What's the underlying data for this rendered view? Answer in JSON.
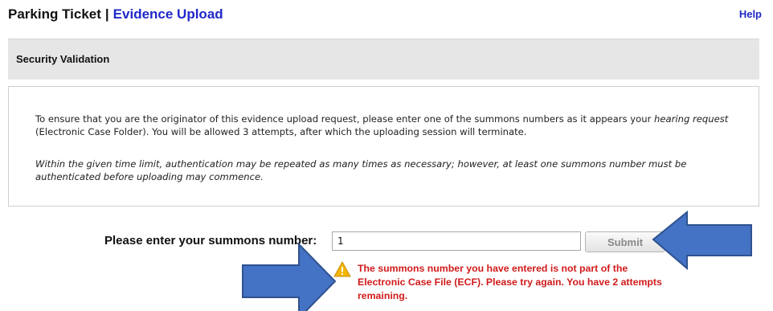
{
  "header": {
    "title": "Parking Ticket",
    "separator": "|",
    "subtitle": "Evidence Upload",
    "help_label": "Help"
  },
  "section": {
    "title": "Security Validation"
  },
  "info": {
    "paragraph1_text1": "To ensure that you are the originator of this evidence upload request, please enter one of the summons numbers as it appears your ",
    "paragraph1_emphasis": "hearing request",
    "paragraph1_text2": " (Electronic Case Folder). You will be allowed 3 attempts, after which the uploading session will terminate.",
    "paragraph2": "Within the given time limit, authentication may be repeated as many times as necessary; however, at least one summons number must be authenticated before uploading may commence."
  },
  "form": {
    "summons_label": "Please enter your summons number:",
    "summons_value": "1",
    "submit_label": "Submit"
  },
  "error": {
    "icon": "warning-icon",
    "message": "The summons number you have entered is not part of the Electronic Case File (ECF). Please try again. You have 2 attempts remaining."
  },
  "colors": {
    "link_blue": "#1f28c8",
    "error_red": "#d11a1a",
    "arrow_blue": "#4472c4",
    "arrow_border": "#2f528f",
    "section_bg": "#e6e6e6",
    "warning_yellow": "#f4b400"
  }
}
